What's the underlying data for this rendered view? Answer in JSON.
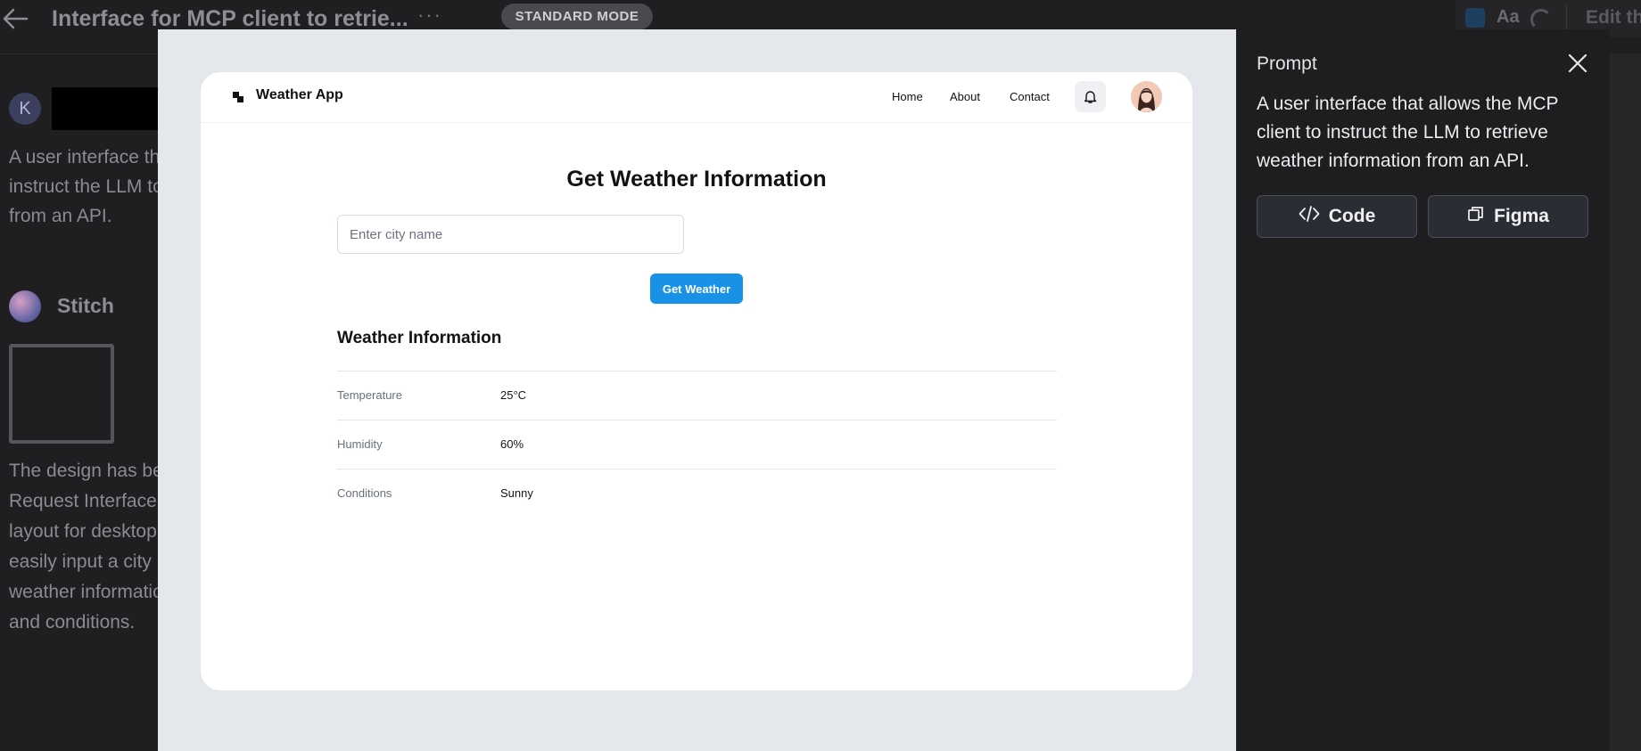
{
  "topbar": {
    "doc_title": "Interface for MCP client to retrie...",
    "more_label": "···",
    "mode_label": "STANDARD MODE",
    "font_label": "Aa",
    "edit_label": "Edit th"
  },
  "chat": {
    "user_initial": "K",
    "user_message": "A user interface th\ninstruct the LLM to\nfrom an API.",
    "assistant_name": "Stitch",
    "assistant_message": "The design has be\nRequest Interface,\nlayout for desktop\neasily input a city\nweather informatio\nand conditions."
  },
  "preview": {
    "app_title": "Weather App",
    "nav": [
      "Home",
      "About",
      "Contact"
    ],
    "page_title": "Get Weather Information",
    "city_placeholder": "Enter city name",
    "button_label": "Get Weather",
    "section_title": "Weather Information",
    "rows": [
      {
        "label": "Temperature",
        "value": "25°C"
      },
      {
        "label": "Humidity",
        "value": "60%"
      },
      {
        "label": "Conditions",
        "value": "Sunny"
      }
    ]
  },
  "panel": {
    "heading": "Prompt",
    "prompt": "A user interface that allows the MCP client to instruct the LLM to retrieve weather information from an API.",
    "code_label": "Code",
    "figma_label": "Figma"
  },
  "colors": {
    "accent": "#1991e6",
    "background": "#1f1f21",
    "modal": "#e4e8ec"
  }
}
